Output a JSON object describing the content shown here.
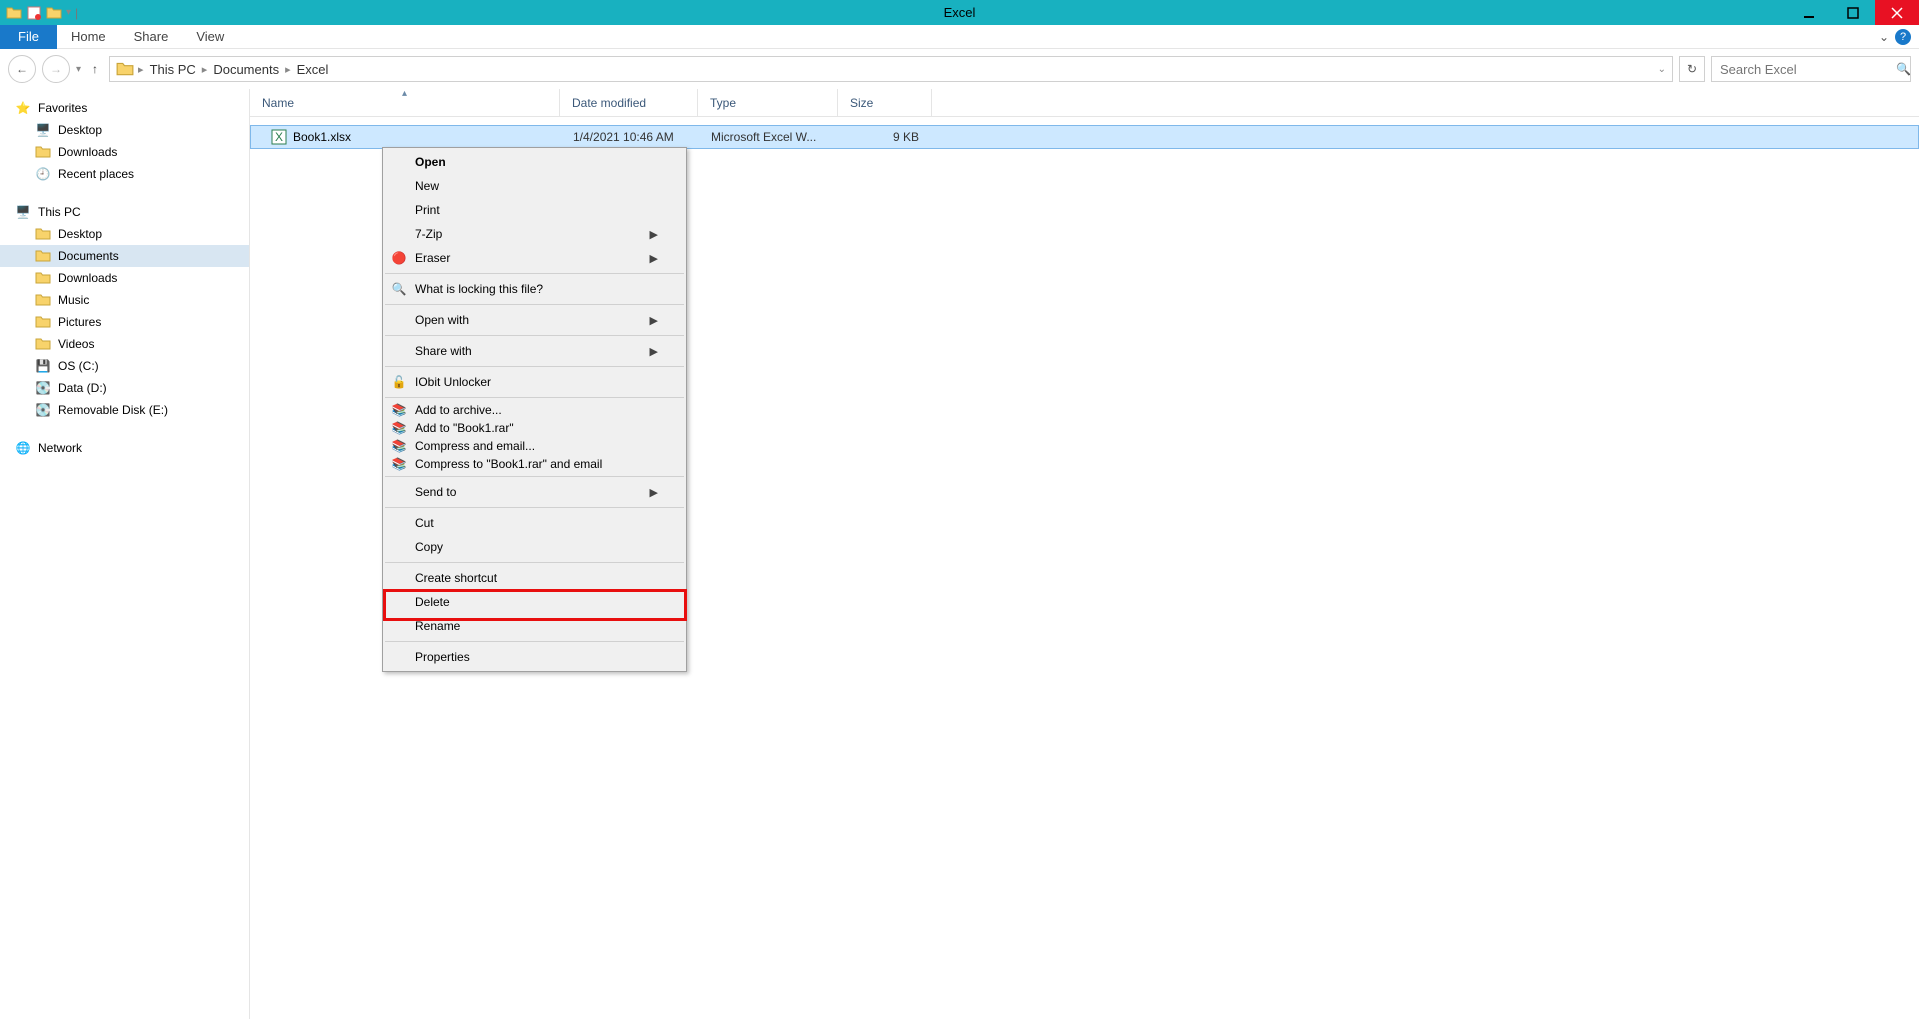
{
  "window": {
    "title": "Excel"
  },
  "ribbon": {
    "file_label": "File",
    "tabs": [
      "Home",
      "Share",
      "View"
    ]
  },
  "breadcrumbs": [
    "This PC",
    "Documents",
    "Excel"
  ],
  "search": {
    "placeholder": "Search Excel"
  },
  "sidebar": {
    "favorites": {
      "heading": "Favorites",
      "items": [
        "Desktop",
        "Downloads",
        "Recent places"
      ]
    },
    "thispc": {
      "heading": "This PC",
      "items": [
        "Desktop",
        "Documents",
        "Downloads",
        "Music",
        "Pictures",
        "Videos",
        "OS (C:)",
        "Data (D:)",
        "Removable Disk (E:)"
      ],
      "selected_index": 1
    },
    "network": {
      "heading": "Network"
    }
  },
  "columns": {
    "name": "Name",
    "date": "Date modified",
    "type": "Type",
    "size": "Size"
  },
  "files": [
    {
      "name": "Book1.xlsx",
      "date": "1/4/2021 10:46 AM",
      "type": "Microsoft Excel W...",
      "size": "9 KB"
    }
  ],
  "context_menu": {
    "open": "Open",
    "new": "New",
    "print": "Print",
    "sevenzip": "7-Zip",
    "eraser": "Eraser",
    "whatlocking": "What is locking this file?",
    "openwith": "Open with",
    "sharewith": "Share with",
    "iobit": "IObit Unlocker",
    "addarchive": "Add to archive...",
    "addbook": "Add to \"Book1.rar\"",
    "compressemail": "Compress and email...",
    "compressbook": "Compress to \"Book1.rar\" and email",
    "sendto": "Send to",
    "cut": "Cut",
    "copy": "Copy",
    "createshortcut": "Create shortcut",
    "delete": "Delete",
    "rename": "Rename",
    "properties": "Properties"
  }
}
